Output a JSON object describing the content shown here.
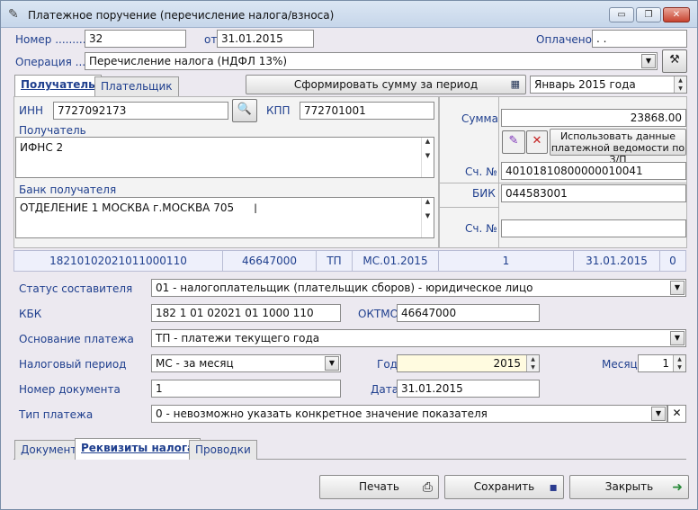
{
  "window": {
    "title": "Платежное поручение (перечисление налога/взноса)",
    "min": "▭",
    "max": "❐",
    "close": "✕"
  },
  "header": {
    "nomer_label": "Номер ..........",
    "nomer": "32",
    "ot_label": "от",
    "date": "31.01.2015",
    "oplacheno_label": "Оплачено",
    "oplacheno": " .  ."
  },
  "operation": {
    "label": "Операция .....",
    "value": "Перечисление налога (НДФЛ 13%)"
  },
  "tabs_top": {
    "poluchatel": "Получатель",
    "platelshik": "Плательщик"
  },
  "form_btn": "Сформировать сумму за период",
  "period": "Январь 2015 года",
  "inn": {
    "label": "ИНН",
    "value": "7727092173"
  },
  "kpp": {
    "label": "КПП",
    "value": "772701001"
  },
  "poluchatel": {
    "label": "Получатель",
    "value": "ИФНС 2"
  },
  "bank": {
    "label": "Банк получателя",
    "value": "ОТДЕЛЕНИЕ 1 МОСКВА г.МОСКВА 705"
  },
  "summa": {
    "label": "Сумма",
    "value": "23868.00"
  },
  "use_btn": "Использовать данные платежной ведомости по З/П",
  "sch1": {
    "label": "Сч. №",
    "value": "40101810800000010041"
  },
  "bik": {
    "label": "БИК",
    "value": "044583001"
  },
  "sch2": {
    "label": "Сч. №",
    "value": ""
  },
  "strip": [
    "18210102021011000110",
    "46647000",
    "ТП",
    "МС.01.2015",
    "1",
    "31.01.2015",
    "0"
  ],
  "status": {
    "label": "Статус составителя",
    "value": "01 - налогоплательщик (плательщик сборов) - юридическое лицо"
  },
  "kbk": {
    "label": "КБК",
    "value": "182 1 01 02021 01 1000 110"
  },
  "oktmo": {
    "label": "ОКТМО",
    "value": "46647000"
  },
  "osnovanie": {
    "label": "Основание платежа",
    "value": "ТП - платежи текущего года"
  },
  "nalog_period": {
    "label": "Налоговый период",
    "value": "МС - за месяц"
  },
  "god": {
    "label": "Год",
    "value": "2015"
  },
  "mesyac": {
    "label": "Месяц",
    "value": "1"
  },
  "nomer_doc": {
    "label": "Номер  документа",
    "value": "1"
  },
  "data": {
    "label": "Дата",
    "value": "31.01.2015"
  },
  "tip": {
    "label": "Тип платежа",
    "value": "0 - невозможно указать конкретное значение показателя"
  },
  "tabs_bottom": {
    "dokument": "Документ",
    "rekvizity": "Реквизиты налога",
    "provodki": "Проводки"
  },
  "buttons": {
    "pechat": "Печать",
    "sohranit": "Сохранить",
    "zakryt": "Закрыть"
  }
}
